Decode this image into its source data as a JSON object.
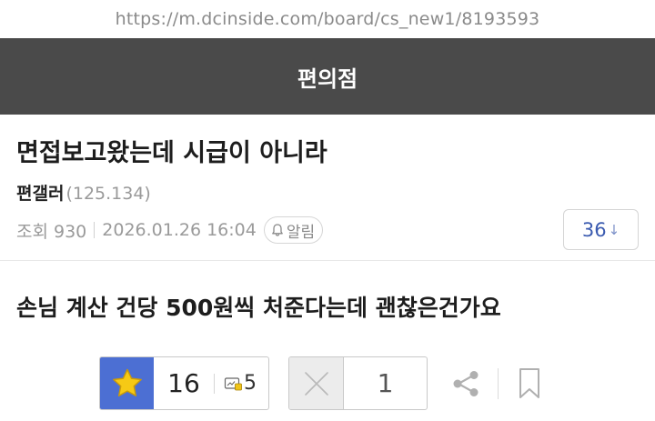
{
  "browser": {
    "url": "https://m.dcinside.com/board/cs_new1/8193593"
  },
  "gallery": {
    "name": "편의점"
  },
  "post": {
    "title": "면접보고왔는데 시급이 아니라",
    "author": "편갤러",
    "author_ip": "(125.134)",
    "views": "조회 930",
    "date": "2026.01.26 16:04",
    "alarm_label": "알림",
    "comment_count": "36",
    "comment_arrow": "↓",
    "body": "손님 계산 건당 500원씩 처준다는데 괜찮은건가요"
  },
  "votes": {
    "up": "16",
    "fixed_up": "5",
    "down": "1"
  },
  "colors": {
    "header_bg": "#4a4a4a",
    "accent_blue": "#4c6fd3",
    "star": "#f6c915",
    "comment_text": "#3b5bb0"
  },
  "icons": [
    "bell-icon",
    "star-icon",
    "fixed-recommend-icon",
    "x-icon",
    "share-icon",
    "bookmark-icon"
  ]
}
